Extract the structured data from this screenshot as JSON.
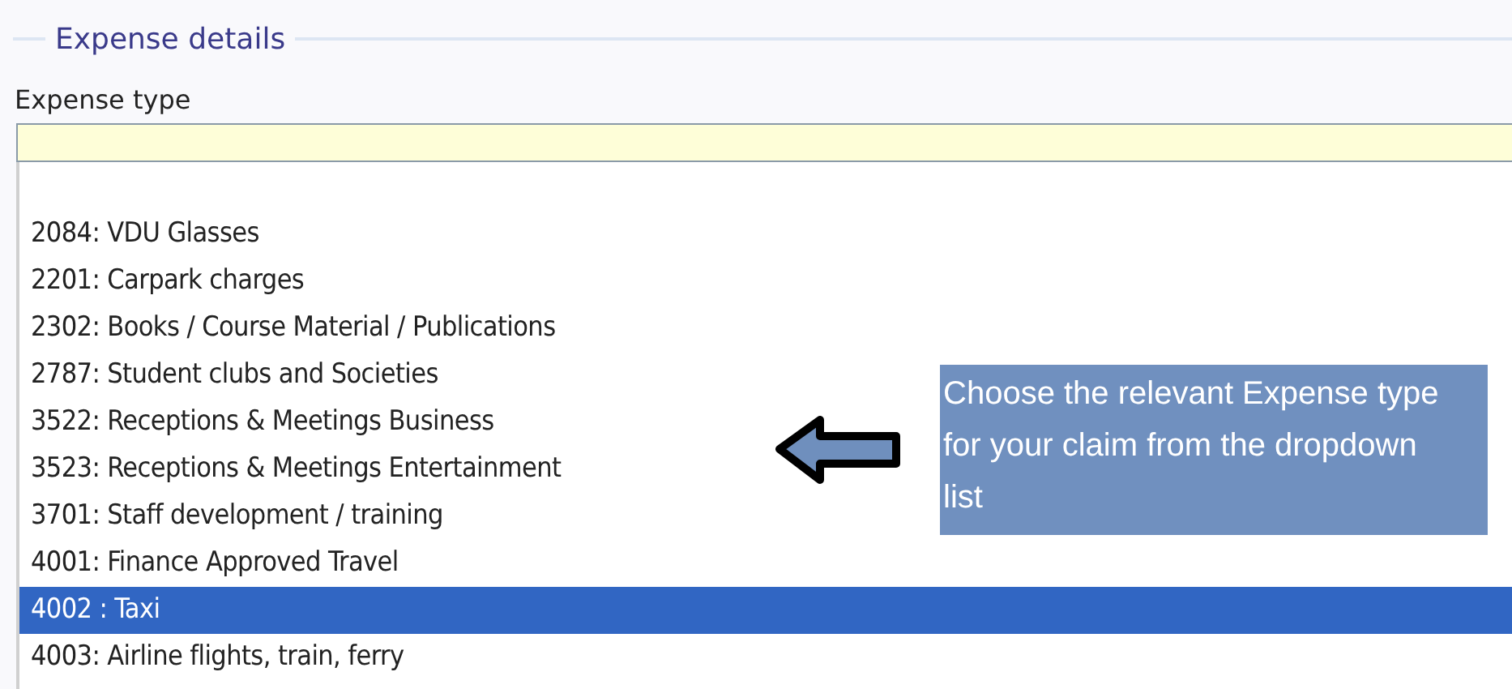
{
  "section": {
    "title": "Expense details"
  },
  "field": {
    "label": "Expense type"
  },
  "dropdown": {
    "items": [
      {
        "label": "2084: VDU Glasses",
        "selected": false
      },
      {
        "label": "2201: Carpark charges",
        "selected": false
      },
      {
        "label": "2302: Books / Course Material / Publications",
        "selected": false
      },
      {
        "label": "2787: Student clubs and Societies",
        "selected": false
      },
      {
        "label": "3522: Receptions & Meetings Business",
        "selected": false
      },
      {
        "label": "3523: Receptions & Meetings Entertainment",
        "selected": false
      },
      {
        "label": "3701: Staff development / training",
        "selected": false
      },
      {
        "label": "4001: Finance Approved Travel",
        "selected": false
      },
      {
        "label": "4002 : Taxi",
        "selected": true
      },
      {
        "label": "4003: Airline flights, train, ferry",
        "selected": false
      }
    ]
  },
  "callout": {
    "text": "Choose the relevant Expense type for your claim from the dropdown list"
  }
}
